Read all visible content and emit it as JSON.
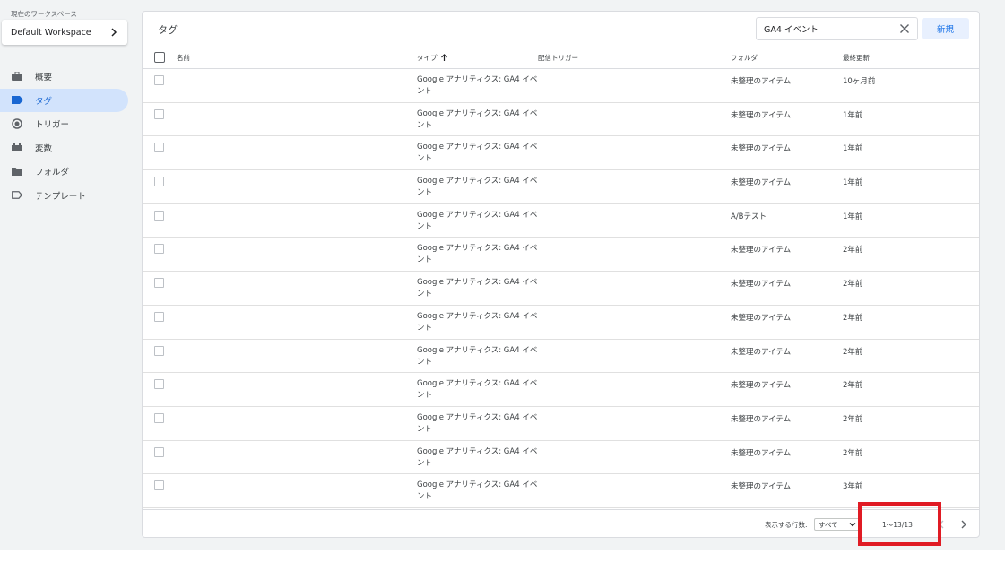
{
  "sidebar": {
    "workspace_caption": "現在のワークスペース",
    "workspace_name": "Default Workspace",
    "items": [
      {
        "label": "概要",
        "icon": "briefcase-icon",
        "active": false
      },
      {
        "label": "タグ",
        "icon": "tag-icon",
        "active": true
      },
      {
        "label": "トリガー",
        "icon": "trigger-icon",
        "active": false
      },
      {
        "label": "変数",
        "icon": "variables-icon",
        "active": false
      },
      {
        "label": "フォルダ",
        "icon": "folder-icon",
        "active": false
      },
      {
        "label": "テンプレート",
        "icon": "label-outline-icon",
        "active": false
      }
    ]
  },
  "main": {
    "title": "タグ",
    "search": {
      "value": "GA4 イベント"
    },
    "new_button": "新規",
    "columns": {
      "name": "名前",
      "type": "タイプ",
      "trigger": "配信トリガー",
      "folder": "フォルダ",
      "updated": "最終更新"
    },
    "rows": [
      {
        "type": "Google アナリティクス: GA4 イベント",
        "folder": "未整理のアイテム",
        "updated": "10ヶ月前"
      },
      {
        "type": "Google アナリティクス: GA4 イベント",
        "folder": "未整理のアイテム",
        "updated": "1年前"
      },
      {
        "type": "Google アナリティクス: GA4 イベント",
        "folder": "未整理のアイテム",
        "updated": "1年前"
      },
      {
        "type": "Google アナリティクス: GA4 イベント",
        "folder": "未整理のアイテム",
        "updated": "1年前"
      },
      {
        "type": "Google アナリティクス: GA4 イベント",
        "folder": "A/Bテスト",
        "updated": "1年前"
      },
      {
        "type": "Google アナリティクス: GA4 イベント",
        "folder": "未整理のアイテム",
        "updated": "2年前"
      },
      {
        "type": "Google アナリティクス: GA4 イベント",
        "folder": "未整理のアイテム",
        "updated": "2年前"
      },
      {
        "type": "Google アナリティクス: GA4 イベント",
        "folder": "未整理のアイテム",
        "updated": "2年前"
      },
      {
        "type": "Google アナリティクス: GA4 イベント",
        "folder": "未整理のアイテム",
        "updated": "2年前"
      },
      {
        "type": "Google アナリティクス: GA4 イベント",
        "folder": "未整理のアイテム",
        "updated": "2年前"
      },
      {
        "type": "Google アナリティクス: GA4 イベント",
        "folder": "未整理のアイテム",
        "updated": "2年前"
      },
      {
        "type": "Google アナリティクス: GA4 イベント",
        "folder": "未整理のアイテム",
        "updated": "2年前"
      },
      {
        "type": "Google アナリティクス: GA4 イベント",
        "folder": "未整理のアイテム",
        "updated": "3年前"
      }
    ],
    "footer": {
      "rows_label": "表示する行数:",
      "rows_value": "すべて",
      "range": "1～13/13"
    }
  },
  "colors": {
    "accent": "#1a73e8",
    "active_bg": "#d2e3fc",
    "highlight": "#e01b24"
  }
}
